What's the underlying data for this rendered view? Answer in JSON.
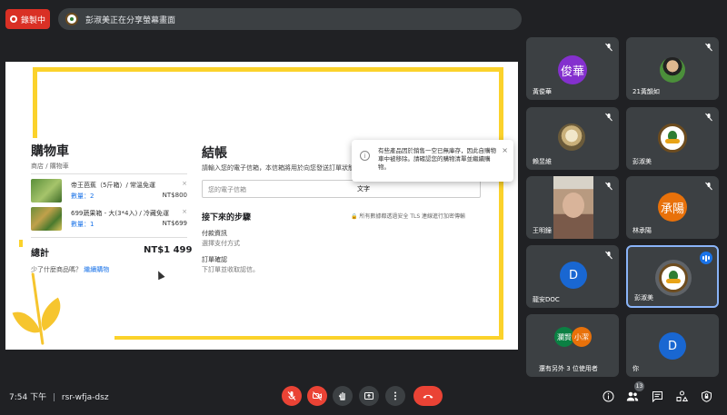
{
  "top": {
    "recording_label": "錄製中",
    "share_notice": "彭淑美正在分享螢幕畫面"
  },
  "shared_screen": {
    "cart": {
      "title": "購物車",
      "breadcrumb": "商店 / 購物車",
      "items": [
        {
          "name": "帝王芭蕉（5斤箱）/ 常溫免運",
          "qty": "數量：2",
          "price": "NT$800",
          "remove": "×"
        },
        {
          "name": "699蔬果箱 - 大(3*4入) / 冷藏免運",
          "qty": "數量：1",
          "price": "NT$699",
          "remove": "×"
        }
      ],
      "total_label": "總計",
      "total_value": "NT$1 499",
      "more_text": "少了什麼商品嗎？",
      "more_link": "繼續購物"
    },
    "checkout": {
      "title": "結帳",
      "description": "請輸入您的電子信箱，本信箱將用於向您發送訂單狀態",
      "email_placeholder": "您的電子信箱",
      "email_overlay_text": "文字",
      "next_steps": "接下來的步驟",
      "secure_note": "所有數據都透過安全 TLS 連線進行加密傳輸",
      "steps": [
        {
          "heading": "付款資訊",
          "sub": "選擇支付方式"
        },
        {
          "heading": "訂單確認",
          "sub": "下訂單並收取認信。"
        }
      ]
    },
    "toast": {
      "icon": "i",
      "message": "有些產品因於銷售一空已無庫存，因此自購物車中被移除。請確認您的購物清單並繼續購物。",
      "close": "×"
    }
  },
  "participants": [
    {
      "name": "黃俊華",
      "avatar_text": "俊華",
      "color": "#8430ce",
      "type": "initials"
    },
    {
      "name": "21黃韻如",
      "type": "photo"
    },
    {
      "name": "賴昱維",
      "type": "photo"
    },
    {
      "name": "彭淑美",
      "type": "logo"
    },
    {
      "name": "王明鐘",
      "type": "video"
    },
    {
      "name": "林承陽",
      "avatar_text": "承陽",
      "color": "#e8710a",
      "type": "initials"
    },
    {
      "name": "龍安DOC",
      "avatar_text": "D",
      "color": "#1967d2",
      "type": "initials"
    },
    {
      "name": "彭淑美",
      "type": "logo",
      "speaking": true
    },
    {
      "name": "還有另外 3 位使用者",
      "avatars": [
        "瀾賢",
        "小潔"
      ],
      "type": "group"
    },
    {
      "name": "你",
      "avatar_text": "D",
      "color": "#1967d2",
      "type": "initials"
    }
  ],
  "bottom": {
    "time": "7:54 下午",
    "separator": "|",
    "meeting_code": "rsr-wfja-dsz",
    "participants_count": "13"
  }
}
